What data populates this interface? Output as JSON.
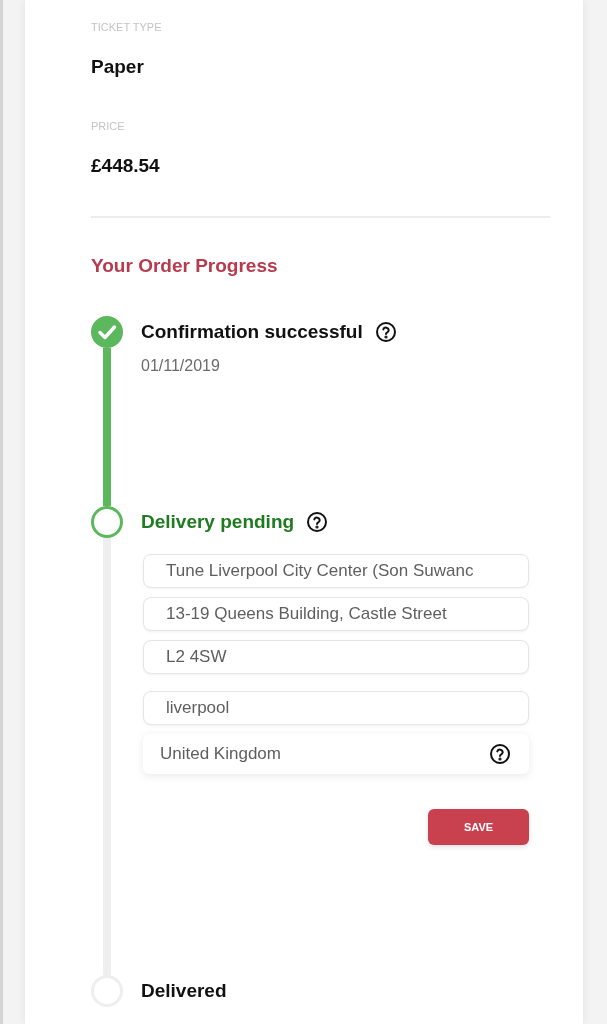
{
  "details": [
    {
      "label": "TICKET TYPE",
      "value": "Paper"
    },
    {
      "label": "PRICE",
      "value": "£448.54"
    }
  ],
  "progress": {
    "title": "Your Order Progress",
    "steps": [
      {
        "title": "Confirmation successful",
        "kind": "done",
        "help": true,
        "date": "01/11/2019"
      },
      {
        "title": "Delivery pending",
        "kind": "current",
        "help": true,
        "form": {
          "field_groups": [
            [
              {
                "kind": "text",
                "value": "Tune Liverpool City Center (Son Suwanc"
              },
              {
                "kind": "text",
                "value": "13-19 Queens Building, Castle Street"
              },
              {
                "kind": "text",
                "value": "L2 4SW"
              }
            ],
            [
              {
                "kind": "text",
                "value": "liverpool"
              },
              {
                "kind": "select",
                "value": "United Kingdom",
                "help": true
              }
            ]
          ],
          "save_button": "SAVE"
        }
      },
      {
        "title": "Delivered",
        "kind": "upcoming",
        "help": false
      }
    ]
  }
}
